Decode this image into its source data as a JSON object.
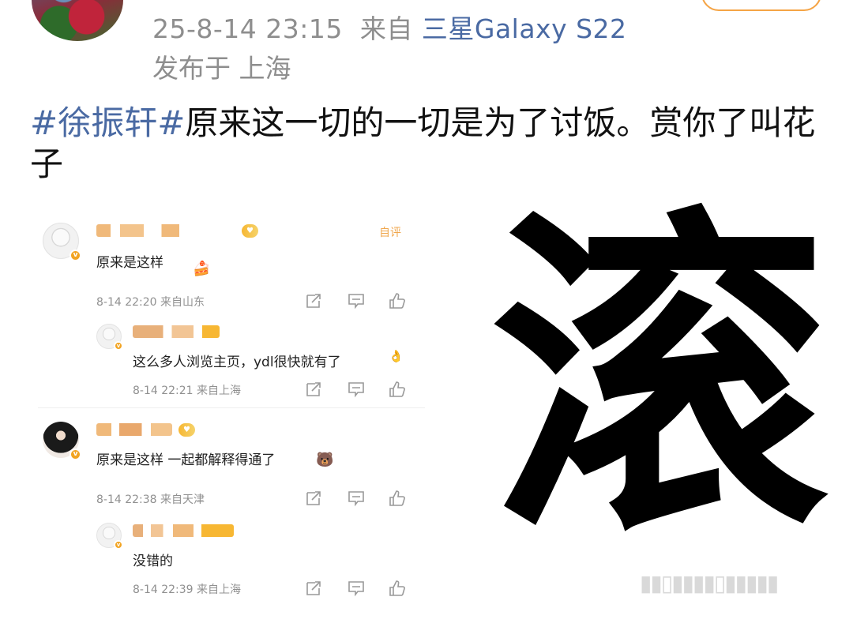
{
  "post": {
    "meta_time": "25-8-14 23:15",
    "meta_from": "来自",
    "meta_device": "三星Galaxy S22",
    "meta_location": "发布于 上海",
    "hashtag": "#徐振轩#",
    "text": "原来这一切的一切是为了讨饭。赏你了叫花子"
  },
  "comments": {
    "author_tag": "自评",
    "items": [
      {
        "text": "原来是这样",
        "time": "8-14 22:20 来自山东",
        "reply": false
      },
      {
        "text": "这么多人浏览主页，ydl很快就有了",
        "time": "8-14 22:21 来自上海",
        "reply": true
      },
      {
        "text": "原来是这样 一起都解释得通了",
        "time": "8-14 22:38 来自天津",
        "reply": false
      },
      {
        "text": "没错的",
        "time": "8-14 22:39 来自上海",
        "reply": true
      }
    ]
  },
  "big_glyph": "滚",
  "icons": [
    "share-icon",
    "comment-icon",
    "like-icon",
    "verified-badge-icon"
  ],
  "colors": {
    "link": "#4a6aa3",
    "meta": "#8e8e8e",
    "badge": "#f2a422",
    "follow_border": "#f5a445"
  }
}
